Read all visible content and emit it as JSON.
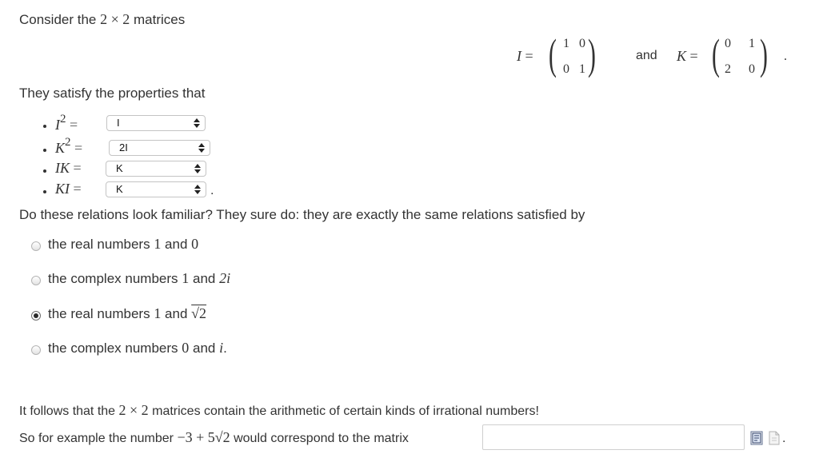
{
  "intro": {
    "prefix": "Consider the",
    "dims_a": "2",
    "times": "×",
    "dims_b": "2",
    "suffix": "matrices"
  },
  "matrices": {
    "I_label": "I",
    "I_equals": "=",
    "I_entries": [
      "1",
      "0",
      "0",
      "1"
    ],
    "and_text": "and",
    "K_label": "K",
    "K_equals": "=",
    "K_entries": [
      "0",
      "1",
      "2",
      "0"
    ],
    "end_period": "."
  },
  "properties": {
    "heading": "They satisfy the properties that",
    "items": [
      {
        "lhs": "I",
        "sup": "2",
        "eq": "=",
        "selected": "I"
      },
      {
        "lhs": "K",
        "sup": "2",
        "eq": "=",
        "selected": "2I"
      },
      {
        "lhs": "IK",
        "sup": "",
        "eq": "=",
        "selected": "K"
      },
      {
        "lhs": "KI",
        "sup": "",
        "eq": "=",
        "selected": "K"
      }
    ],
    "trailing_period": "."
  },
  "question": "Do these relations look familiar? They sure do: they are exactly the same relations satisfied by",
  "options": [
    {
      "text_a": "the real numbers",
      "m1": "1",
      "text_b": "and",
      "m2": "0",
      "tail": "",
      "checked": false
    },
    {
      "text_a": "the complex numbers",
      "m1": "1",
      "text_b": "and",
      "m2": "2i",
      "tail": "",
      "checked": false
    },
    {
      "text_a": "the real numbers",
      "m1": "1",
      "text_b": "and",
      "m2": "√2",
      "tail": "",
      "checked": true
    },
    {
      "text_a": "the complex numbers",
      "m1": "0",
      "text_b": "and",
      "m2": "i",
      "tail": ".",
      "checked": false
    }
  ],
  "conclusion": {
    "line1_a": "It follows that the",
    "line1_math": "2 × 2",
    "line1_b": "matrices contain the arithmetic of certain kinds of irrational numbers!",
    "line2_a": "So for example the number",
    "line2_math": "−3 + 5√2",
    "line2_b": "would correspond to the matrix",
    "answer_value": "",
    "end_period": "."
  },
  "icons": [
    "matrix-editor-icon",
    "document-icon"
  ]
}
